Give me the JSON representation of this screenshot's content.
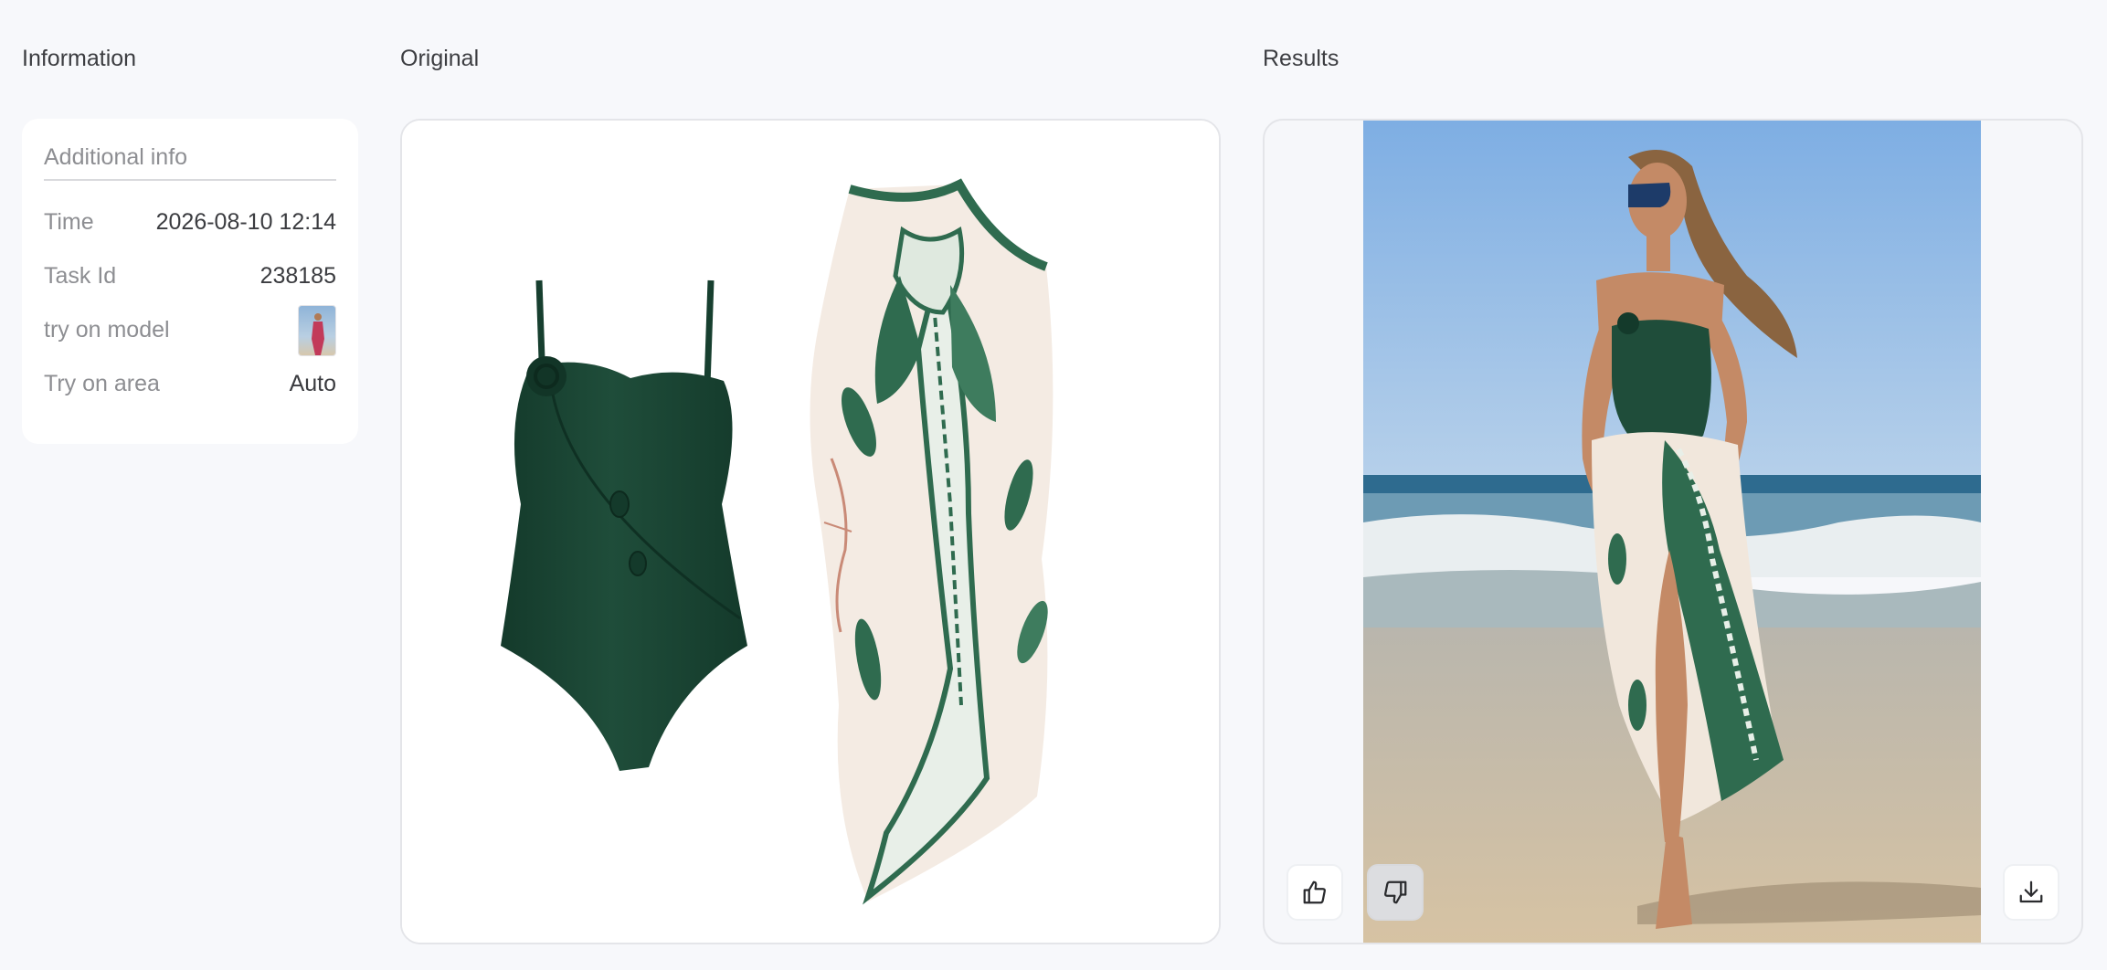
{
  "sections": {
    "information": "Information",
    "original": "Original",
    "results": "Results"
  },
  "info_card": {
    "heading": "Additional info",
    "rows": [
      {
        "key": "Time",
        "value": "2026-08-10 12:14"
      },
      {
        "key": "Task Id",
        "value": "238185"
      },
      {
        "key": "try on model",
        "value": ""
      },
      {
        "key": "Try on area",
        "value": "Auto"
      }
    ]
  },
  "icons": {
    "like": "thumbs-up-icon",
    "dislike": "thumbs-down-icon",
    "download": "download-icon"
  },
  "colors": {
    "garment_green": "#1f4d3a",
    "background": "#f7f8fb"
  }
}
